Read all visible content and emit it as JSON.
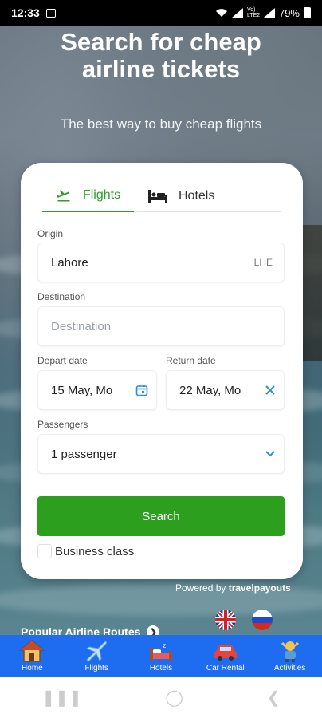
{
  "status": {
    "time": "12:33",
    "network": "Vo) LTE2",
    "battery": "79%"
  },
  "hero": {
    "title_line1": "Search for cheap",
    "title_line2": "airline tickets",
    "subtitle": "The best way to buy cheap flights"
  },
  "tabs": [
    {
      "label": "Flights",
      "icon": "plane-icon",
      "active": true
    },
    {
      "label": "Hotels",
      "icon": "bed-icon",
      "active": false
    }
  ],
  "form": {
    "origin_label": "Origin",
    "origin_value": "Lahore",
    "origin_code": "LHE",
    "destination_label": "Destination",
    "destination_placeholder": "Destination",
    "depart_label": "Depart date",
    "depart_value": "15 May, Mo",
    "return_label": "Return date",
    "return_value": "22 May, Mo",
    "passengers_label": "Passengers",
    "passengers_value": "1 passenger",
    "search_label": "Search",
    "business_class_label": "Business class"
  },
  "powered": {
    "prefix": "Powered by",
    "brand": "travelpayouts"
  },
  "popular_routes": "Popular Airline Routes",
  "bottom_nav": [
    {
      "label": "Home",
      "icon": "home-icon"
    },
    {
      "label": "Flights",
      "icon": "plane-icon"
    },
    {
      "label": "Hotels",
      "icon": "hotel-bed-icon"
    },
    {
      "label": "Car Rental",
      "icon": "car-icon"
    },
    {
      "label": "Activities",
      "icon": "person-icon"
    }
  ],
  "colors": {
    "accent_green": "#2c9f1e",
    "nav_blue": "#1e6cf0"
  }
}
